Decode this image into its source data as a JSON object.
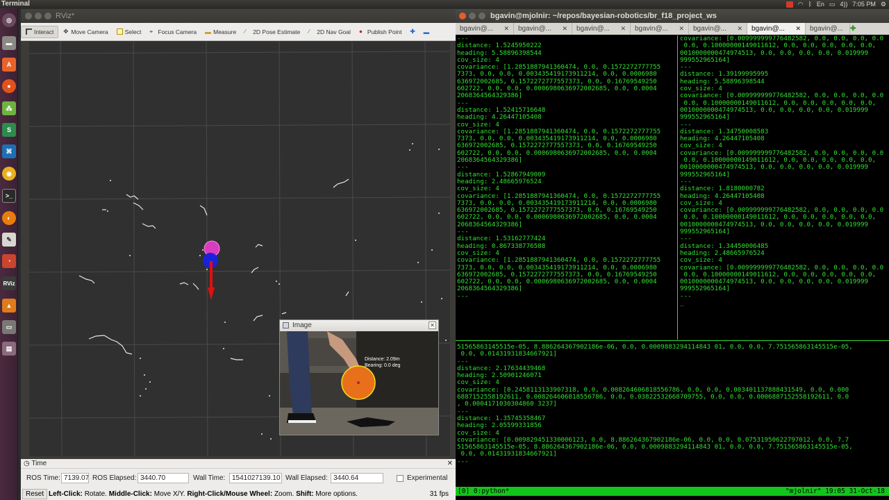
{
  "topbar": {
    "app_title": "Terminal",
    "tray": [
      "En",
      "4))",
      "7:05 PM"
    ]
  },
  "launcher": {
    "items": [
      "dash-icon",
      "files-icon",
      "software-center-icon",
      "firefox-icon",
      "app-icon",
      "app-icon",
      "vscode-icon",
      "chrome-icon",
      "terminal-icon",
      "blender-icon",
      "text-editor-icon",
      "app-icon",
      "rviz-icon",
      "matlab-icon",
      "drive-icon",
      "trash-icon"
    ]
  },
  "rviz": {
    "title": "RViz*",
    "tools": [
      "Interact",
      "Move Camera",
      "Select",
      "Focus Camera",
      "Measure",
      "2D Pose Estimate",
      "2D Nav Goal",
      "Publish Point"
    ],
    "time_panel": {
      "header": "Time",
      "ros_time_label": "ROS Time:",
      "ros_time_value": "7139.07",
      "ros_elapsed_label": "ROS Elapsed:",
      "ros_elapsed_value": "3440.70",
      "wall_time_label": "Wall Time:",
      "wall_time_value": "1541027139.10",
      "wall_elapsed_label": "Wall Elapsed:",
      "wall_elapsed_value": "3440.64",
      "experimental_label": "Experimental"
    },
    "status": {
      "reset_label": "Reset",
      "left_click_key": "Left-Click:",
      "left_click_text": "Rotate.",
      "middle_click_key": "Middle-Click:",
      "middle_click_text": "Move X/Y.",
      "right_click_key": "Right-Click/Mouse Wheel:",
      "right_click_text": "Zoom.",
      "shift_key": "Shift:",
      "shift_text": "More options.",
      "fps": "31 fps"
    },
    "image_window": {
      "title": "Image",
      "distance_text": "Distance: 2.09m",
      "bearing_text": "Bearing:   0.0 deg"
    }
  },
  "terminal": {
    "title": "bgavin@mjolnir: ~/repos/bayesian-robotics/br_f18_project_ws",
    "tabs": [
      "bgavin@...",
      "bgavin@...",
      "bgavin@...",
      "bgavin@...",
      "bgavin@...",
      "bgavin@...",
      "bgavin@..."
    ],
    "active_tab": 5,
    "pane_top_left": [
      "---",
      "distance: 1.5245950222",
      "heading: 5.58896398544",
      "cov_size: 4",
      "covariance: [1.2851887941360474, 0.0, 0.1572272777755",
      "7373, 0.0, 0.0, 0.003435419173911214, 0.0, 0.0006980",
      "636972002685, 0.1572272777557373, 0.0, 0.16769549250",
      "602722, 0.0, 0.0, 0.0006980636972002685, 0.0, 0.0004",
      "2068364564329386]",
      "---",
      "distance: 1.52415716648",
      "heading: 4.26447105408",
      "cov_size: 4",
      "covariance: [1.2851887941360474, 0.0, 0.1572272777755",
      "7373, 0.0, 0.0, 0.003435419173911214, 0.0, 0.0006980",
      "636972002685, 0.1572272777557373, 0.0, 0.16769549250",
      "602722, 0.0, 0.0, 0.0006980636972002685, 0.0, 0.0004",
      "2068364564329386]",
      "---",
      "distance: 1.52867949009",
      "heading: 2.48665976524",
      "cov_size: 4",
      "covariance: [1.2851887941360474, 0.0, 0.1572272777755",
      "7373, 0.0, 0.0, 0.003435419173911214, 0.0, 0.0006980",
      "636972002685, 0.1572272777557373, 0.0, 0.16769549250",
      "602722, 0.0, 0.0, 0.0006980636972002685, 0.0, 0.0004",
      "2068364564329386]",
      "---",
      "distance: 1.53162777424",
      "heading: 0.867338776588",
      "cov_size: 4",
      "covariance: [1.2851887941360474, 0.0, 0.1572272777755",
      "7373, 0.0, 0.0, 0.003435419173911214, 0.0, 0.0006980",
      "636972002685, 0.1572272777557373, 0.0, 0.16769549250",
      "602722, 0.0, 0.0, 0.0006980636972002685, 0.0, 0.0004",
      "2068364564329386]",
      "---"
    ],
    "pane_top_right": [
      "covariance: [0.009999999776482582, 0.0, 0.0, 0.0, 0.0",
      " 0.0, 0.10000000149011612, 0.0, 0.0, 0.0, 0.0, 0.0,",
      "0010000000474974513, 0.0, 0.0, 0.0, 0.0, 0.019999",
      "999552965164]",
      "---",
      "distance: 1.39199995995",
      "heading: 5.58896398544",
      "cov_size: 4",
      "covariance: [0.009999999776482582, 0.0, 0.0, 0.0, 0.0",
      " 0.0, 0.10000000149011612, 0.0, 0.0, 0.0, 0.0, 0.0,",
      "0010000000474974513, 0.0, 0.0, 0.0, 0.0, 0.019999",
      "999552965164]",
      "---",
      "distance: 1.34750008583",
      "heading: 4.26447105408",
      "cov_size: 4",
      "covariance: [0.009999999776482582, 0.0, 0.0, 0.0, 0.0",
      " 0.0, 0.10000000149011612, 0.0, 0.0, 0.0, 0.0, 0.0,",
      "0010000000474974513, 0.0, 0.0, 0.0, 0.0, 0.019999",
      "999552965164]",
      "---",
      "distance: 1.8180000782",
      "heading: 4.26447105408",
      "cov_size: 4",
      "covariance: [0.009999999776482582, 0.0, 0.0, 0.0, 0.0",
      " 0.0, 0.10000000149011612, 0.0, 0.0, 0.0, 0.0, 0.0,",
      "0010000000474974513, 0.0, 0.0, 0.0, 0.0, 0.019999",
      "999552965164]",
      "---",
      "distance: 1.34450006485",
      "heading: 2.48665976524",
      "cov_size: 4",
      "covariance: [0.009999999776482582, 0.0, 0.0, 0.0, 0.0",
      " 0.0, 0.10000000149011612, 0.0, 0.0, 0.0, 0.0, 0.0,",
      "0010000000474974513, 0.0, 0.0, 0.0, 0.0, 0.019999",
      "999552965164]",
      "---",
      "_"
    ],
    "pane_bottom": [
      "51565863145515e-05, 8.886264367902186e-06, 0.0, 0.0009883294114843 01, 0.0, 0.0, 7.751565863145515e-05,",
      " 0.0, 0.01431931834667921]",
      "---",
      "distance: 2.17634439468",
      "heading: 2.50901246071",
      "cov_size: 4",
      "covariance: [0.2458113133907318, 0.0, 0.008264606818556786, 0.0, 0.0, 0.003401137888431549, 0.0, 0.000",
      "6887152558192611, 0.008264606818556786, 0.0, 0.03822532668709755, 0.0, 0.0, 0.0006887152558192611, 0.0",
      ", 0.0004171030304860 3237]",
      "---",
      "distance: 1.35745358467",
      "heading: 2.05599331856",
      "cov_size: 4",
      "covariance: [0.009829451330006123, 0.0, 8.886264367902186e-06, 0.0, 0.0, 0.07531950622797012, 0.0, 7.7",
      "51565863145515e-05, 8.886264367902186e-06, 0.0, 0.0009883294114843 01, 0.0, 0.0, 7.751565863145515e-05,",
      " 0.0, 0.01431931834667921]",
      "---"
    ],
    "tmux_left": "[0] 0:python*",
    "tmux_right": "\"mjolnir\" 19:05 31-Oct-18"
  },
  "colors": {
    "terminal_text": "#33e033",
    "tmux_bar": "#13c51b",
    "arrow": "#e01010",
    "robot_blue": "#1a22d8",
    "ball_magenta": "#d83cc0"
  }
}
